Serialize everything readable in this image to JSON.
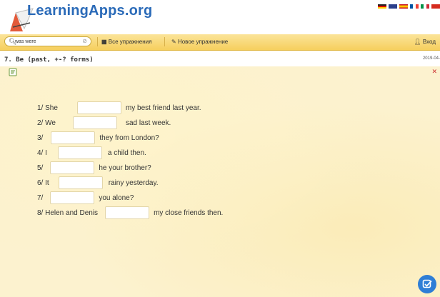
{
  "header": {
    "logo_text": "LearningApps.org"
  },
  "toolbar": {
    "search_value": "was were",
    "all_exercises": "Все упражнения",
    "new_exercise": "Новое упражнение",
    "login": "Вход"
  },
  "exercise": {
    "title": "7. Be (past, +-? forms)",
    "date": "2019-04-",
    "rows": [
      {
        "before": "1/ She",
        "after": "my best friend last year."
      },
      {
        "before": "2/ We",
        "after": "sad last week."
      },
      {
        "before": "3/",
        "after": "they from London?"
      },
      {
        "before": "4/ I",
        "after": "a child then."
      },
      {
        "before": "5/",
        "after": "he your brother?"
      },
      {
        "before": "6/ It",
        "after": "rainy yesterday."
      },
      {
        "before": "7/",
        "after": "you alone?"
      },
      {
        "before": "8/ Helen and Denis",
        "after": "my close friends then."
      }
    ]
  },
  "colors": {
    "toolbar": "#f6cf5d",
    "exercise_bg": "#fcf2cf",
    "check_button": "#2f7ed6",
    "logo": "#2a6ab8"
  }
}
